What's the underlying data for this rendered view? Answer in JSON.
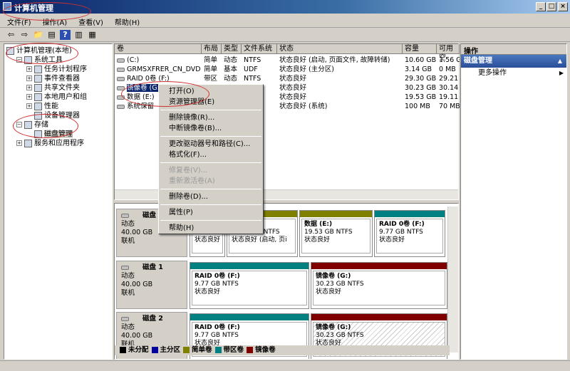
{
  "window": {
    "title": "计算机管理"
  },
  "menu": [
    "文件(F)",
    "操作(A)",
    "查看(V)",
    "帮助(H)"
  ],
  "toolbar": [
    "back-icon",
    "forward-icon",
    "up-folder-icon",
    "show-hide-tree-icon",
    "help-icon",
    "show-hide-action-icon",
    "properties-icon"
  ],
  "tree": [
    {
      "label": "计算机管理(本地)",
      "level": 0,
      "expander": ""
    },
    {
      "label": "系统工具",
      "level": 1,
      "expander": "−"
    },
    {
      "label": "任务计划程序",
      "level": 2,
      "expander": "+"
    },
    {
      "label": "事件查看器",
      "level": 2,
      "expander": "+"
    },
    {
      "label": "共享文件夹",
      "level": 2,
      "expander": "+"
    },
    {
      "label": "本地用户和组",
      "level": 2,
      "expander": "+"
    },
    {
      "label": "性能",
      "level": 2,
      "expander": "+"
    },
    {
      "label": "设备管理器",
      "level": 2,
      "expander": ""
    },
    {
      "label": "存储",
      "level": 1,
      "expander": "−"
    },
    {
      "label": "磁盘管理",
      "level": 2,
      "expander": "",
      "selected": true
    },
    {
      "label": "服务和应用程序",
      "level": 1,
      "expander": "+"
    }
  ],
  "volumes": {
    "columns": [
      "卷",
      "布局",
      "类型",
      "文件系统",
      "状态",
      "容量",
      "可用空"
    ],
    "rows": [
      [
        "(C:)",
        "简单",
        "动态",
        "NTFS",
        "状态良好 (启动, 页面文件, 故障转储)",
        "10.60 GB",
        "1.56 G"
      ],
      [
        "GRMSXFRER_CN_DVD (D:)",
        "简单",
        "基本",
        "UDF",
        "状态良好 (主分区)",
        "3.14 GB",
        "0 MB"
      ],
      [
        "RAID 0卷 (F:)",
        "带区",
        "动态",
        "NTFS",
        "状态良好",
        "29.30 GB",
        "29.21"
      ],
      [
        "镜像卷 (G:)",
        "",
        "",
        "",
        "状态良好",
        "30.23 GB",
        "30.14"
      ],
      [
        "数据 (E:)",
        "",
        "",
        "",
        "状态良好",
        "19.53 GB",
        "19.11"
      ],
      [
        "系统保留",
        "",
        "",
        "",
        "状态良好 (系统)",
        "100 MB",
        "70 MB"
      ]
    ]
  },
  "disks": [
    {
      "name": "磁盘 0",
      "type": "动态",
      "size": "40.00 GB",
      "state": "联机",
      "parts": [
        {
          "title": "",
          "size": "100 MB N",
          "status": "状态良好",
          "color": "#808000"
        },
        {
          "title": "",
          "size": "10.60 GB NTFS",
          "status": "状态良好 (启动, 页i",
          "color": "#808000"
        },
        {
          "title": "数据 (E:)",
          "size": "19.53 GB NTFS",
          "status": "状态良好",
          "color": "#808000"
        },
        {
          "title": "RAID 0卷 (F:)",
          "size": "9.77 GB NTFS",
          "status": "状态良好",
          "color": "#008080"
        }
      ]
    },
    {
      "name": "磁盘 1",
      "type": "动态",
      "size": "40.00 GB",
      "state": "联机",
      "parts": [
        {
          "title": "RAID 0卷 (F:)",
          "size": "9.77 GB NTFS",
          "status": "状态良好",
          "color": "#008080"
        },
        {
          "title": "镜像卷 (G:)",
          "size": "30.23 GB NTFS",
          "status": "状态良好",
          "color": "#800000"
        }
      ]
    },
    {
      "name": "磁盘 2",
      "type": "动态",
      "size": "40.00 GB",
      "state": "联机",
      "parts": [
        {
          "title": "RAID 0卷 (F:)",
          "size": "9.77 GB NTFS",
          "status": "状态良好",
          "color": "#008080"
        },
        {
          "title": "镜像卷 (G:)",
          "size": "30.23 GB NTFS",
          "status": "状态良好",
          "color": "#800000"
        }
      ]
    }
  ],
  "legend": [
    {
      "label": "未分配",
      "color": "#000000"
    },
    {
      "label": "主分区",
      "color": "#0000a0"
    },
    {
      "label": "简单卷",
      "color": "#808000"
    },
    {
      "label": "带区卷",
      "color": "#008080"
    },
    {
      "label": "镜像卷",
      "color": "#800000"
    }
  ],
  "actions": {
    "header": "操作",
    "section": "磁盘管理",
    "item": "更多操作"
  },
  "context_menu": [
    [
      {
        "label": "打开(O)"
      },
      {
        "label": "资源管理器(E)"
      }
    ],
    [
      {
        "label": "删除镜像(R)..."
      },
      {
        "label": "中断镜像卷(B)..."
      }
    ],
    [
      {
        "label": "更改驱动器号和路径(C)..."
      },
      {
        "label": "格式化(F)..."
      }
    ],
    [
      {
        "label": "修复卷(V)...",
        "disabled": true
      },
      {
        "label": "重新激活卷(A)",
        "disabled": true
      }
    ],
    [
      {
        "label": "删除卷(D)..."
      }
    ],
    [
      {
        "label": "属性(P)"
      }
    ],
    [
      {
        "label": "帮助(H)"
      }
    ]
  ]
}
